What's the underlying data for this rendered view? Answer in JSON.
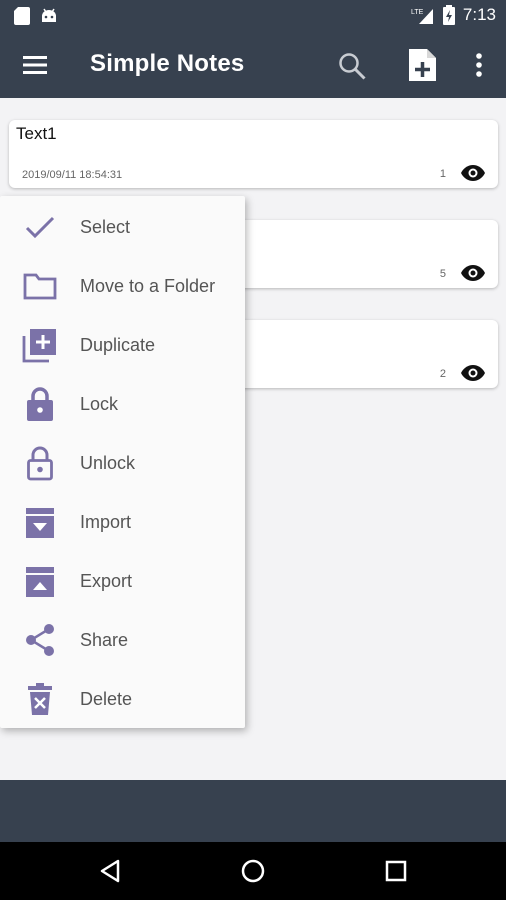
{
  "status_bar": {
    "time": "7:13",
    "network": "LTE"
  },
  "app_bar": {
    "title": "Simple Notes"
  },
  "notes": [
    {
      "title": "Text1",
      "date": "2019/09/11 18:54:31",
      "count": "1"
    },
    {
      "title": "",
      "date": "",
      "count": "5"
    },
    {
      "title": "",
      "date": "",
      "count": "2"
    }
  ],
  "menu": [
    {
      "label": "Select",
      "icon": "check-icon"
    },
    {
      "label": "Move to a Folder",
      "icon": "folder-icon"
    },
    {
      "label": "Duplicate",
      "icon": "duplicate-icon"
    },
    {
      "label": "Lock",
      "icon": "lock-icon"
    },
    {
      "label": "Unlock",
      "icon": "unlock-icon"
    },
    {
      "label": "Import",
      "icon": "import-icon"
    },
    {
      "label": "Export",
      "icon": "export-icon"
    },
    {
      "label": "Share",
      "icon": "share-icon"
    },
    {
      "label": "Delete",
      "icon": "delete-icon"
    }
  ],
  "colors": {
    "primary_dark": "#37414f",
    "accent": "#7b72a8",
    "background": "#f3f3f5"
  }
}
